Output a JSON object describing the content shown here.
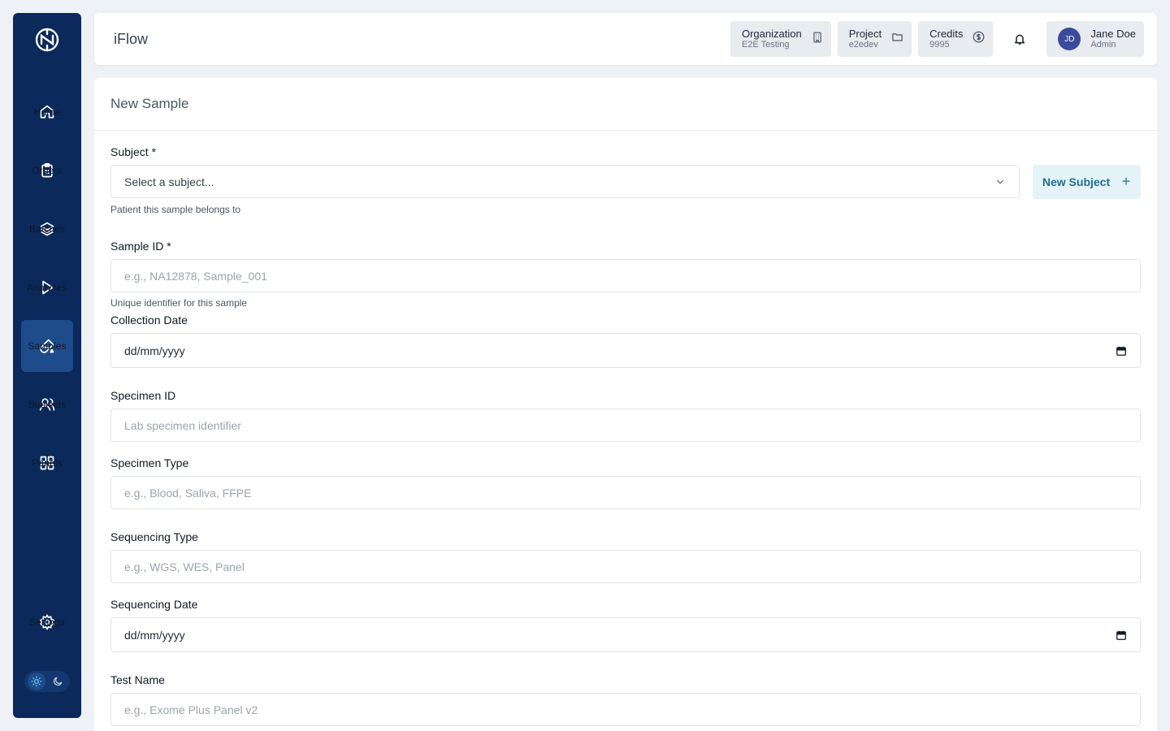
{
  "app": {
    "title": "iFlow"
  },
  "sidebar": {
    "items": [
      {
        "label": "Home",
        "icon": "home-icon"
      },
      {
        "label": "Orders",
        "icon": "clipboard-icon"
      },
      {
        "label": "Batches",
        "icon": "layers-icon"
      },
      {
        "label": "Analyses",
        "icon": "play-icon"
      },
      {
        "label": "Samples",
        "icon": "flask-icon",
        "active": true
      },
      {
        "label": "Subjects",
        "icon": "users-icon"
      },
      {
        "label": "Panels",
        "icon": "grid-icon"
      }
    ],
    "settings_label": "Settings"
  },
  "header": {
    "organization": {
      "label": "Organization",
      "value": "E2E Testing"
    },
    "project": {
      "label": "Project",
      "value": "e2edev"
    },
    "credits": {
      "label": "Credits",
      "value": "9995"
    },
    "user": {
      "initials": "JD",
      "name": "Jane Doe",
      "role": "Admin"
    }
  },
  "page": {
    "title": "New Sample",
    "subject": {
      "label": "Subject *",
      "placeholder": "Select a subject...",
      "hint": "Patient this sample belongs to",
      "new_button": "New Subject"
    },
    "sample_id": {
      "label": "Sample ID *",
      "placeholder": "e.g., NA12878, Sample_001",
      "hint": "Unique identifier for this sample"
    },
    "collection_date": {
      "label": "Collection Date",
      "value": "dd/mm/yyyy"
    },
    "specimen_id": {
      "label": "Specimen ID",
      "placeholder": "Lab specimen identifier"
    },
    "specimen_type": {
      "label": "Specimen Type",
      "placeholder": "e.g., Blood, Saliva, FFPE"
    },
    "sequencing_type": {
      "label": "Sequencing Type",
      "placeholder": "e.g., WGS, WES, Panel"
    },
    "sequencing_date": {
      "label": "Sequencing Date",
      "value": "dd/mm/yyyy"
    },
    "test_name": {
      "label": "Test Name",
      "placeholder": "e.g., Exome Plus Panel v2"
    }
  },
  "colors": {
    "sidebar": "#0b2a5b",
    "active": "#1e4b8a",
    "accent": "#1f6f8b",
    "accent_bg": "#e3f3f8"
  }
}
